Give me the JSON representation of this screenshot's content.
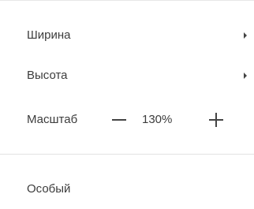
{
  "menu": {
    "width_item": {
      "label": "Ширина",
      "submenu_icon": "chevron-right-icon"
    },
    "height_item": {
      "label": "Высота",
      "submenu_icon": "chevron-right-icon"
    },
    "zoom": {
      "label": "Масштаб",
      "value": "130%",
      "decrease_icon": "minus-icon",
      "increase_icon": "plus-icon"
    },
    "custom_item": {
      "label": "Особый"
    }
  }
}
